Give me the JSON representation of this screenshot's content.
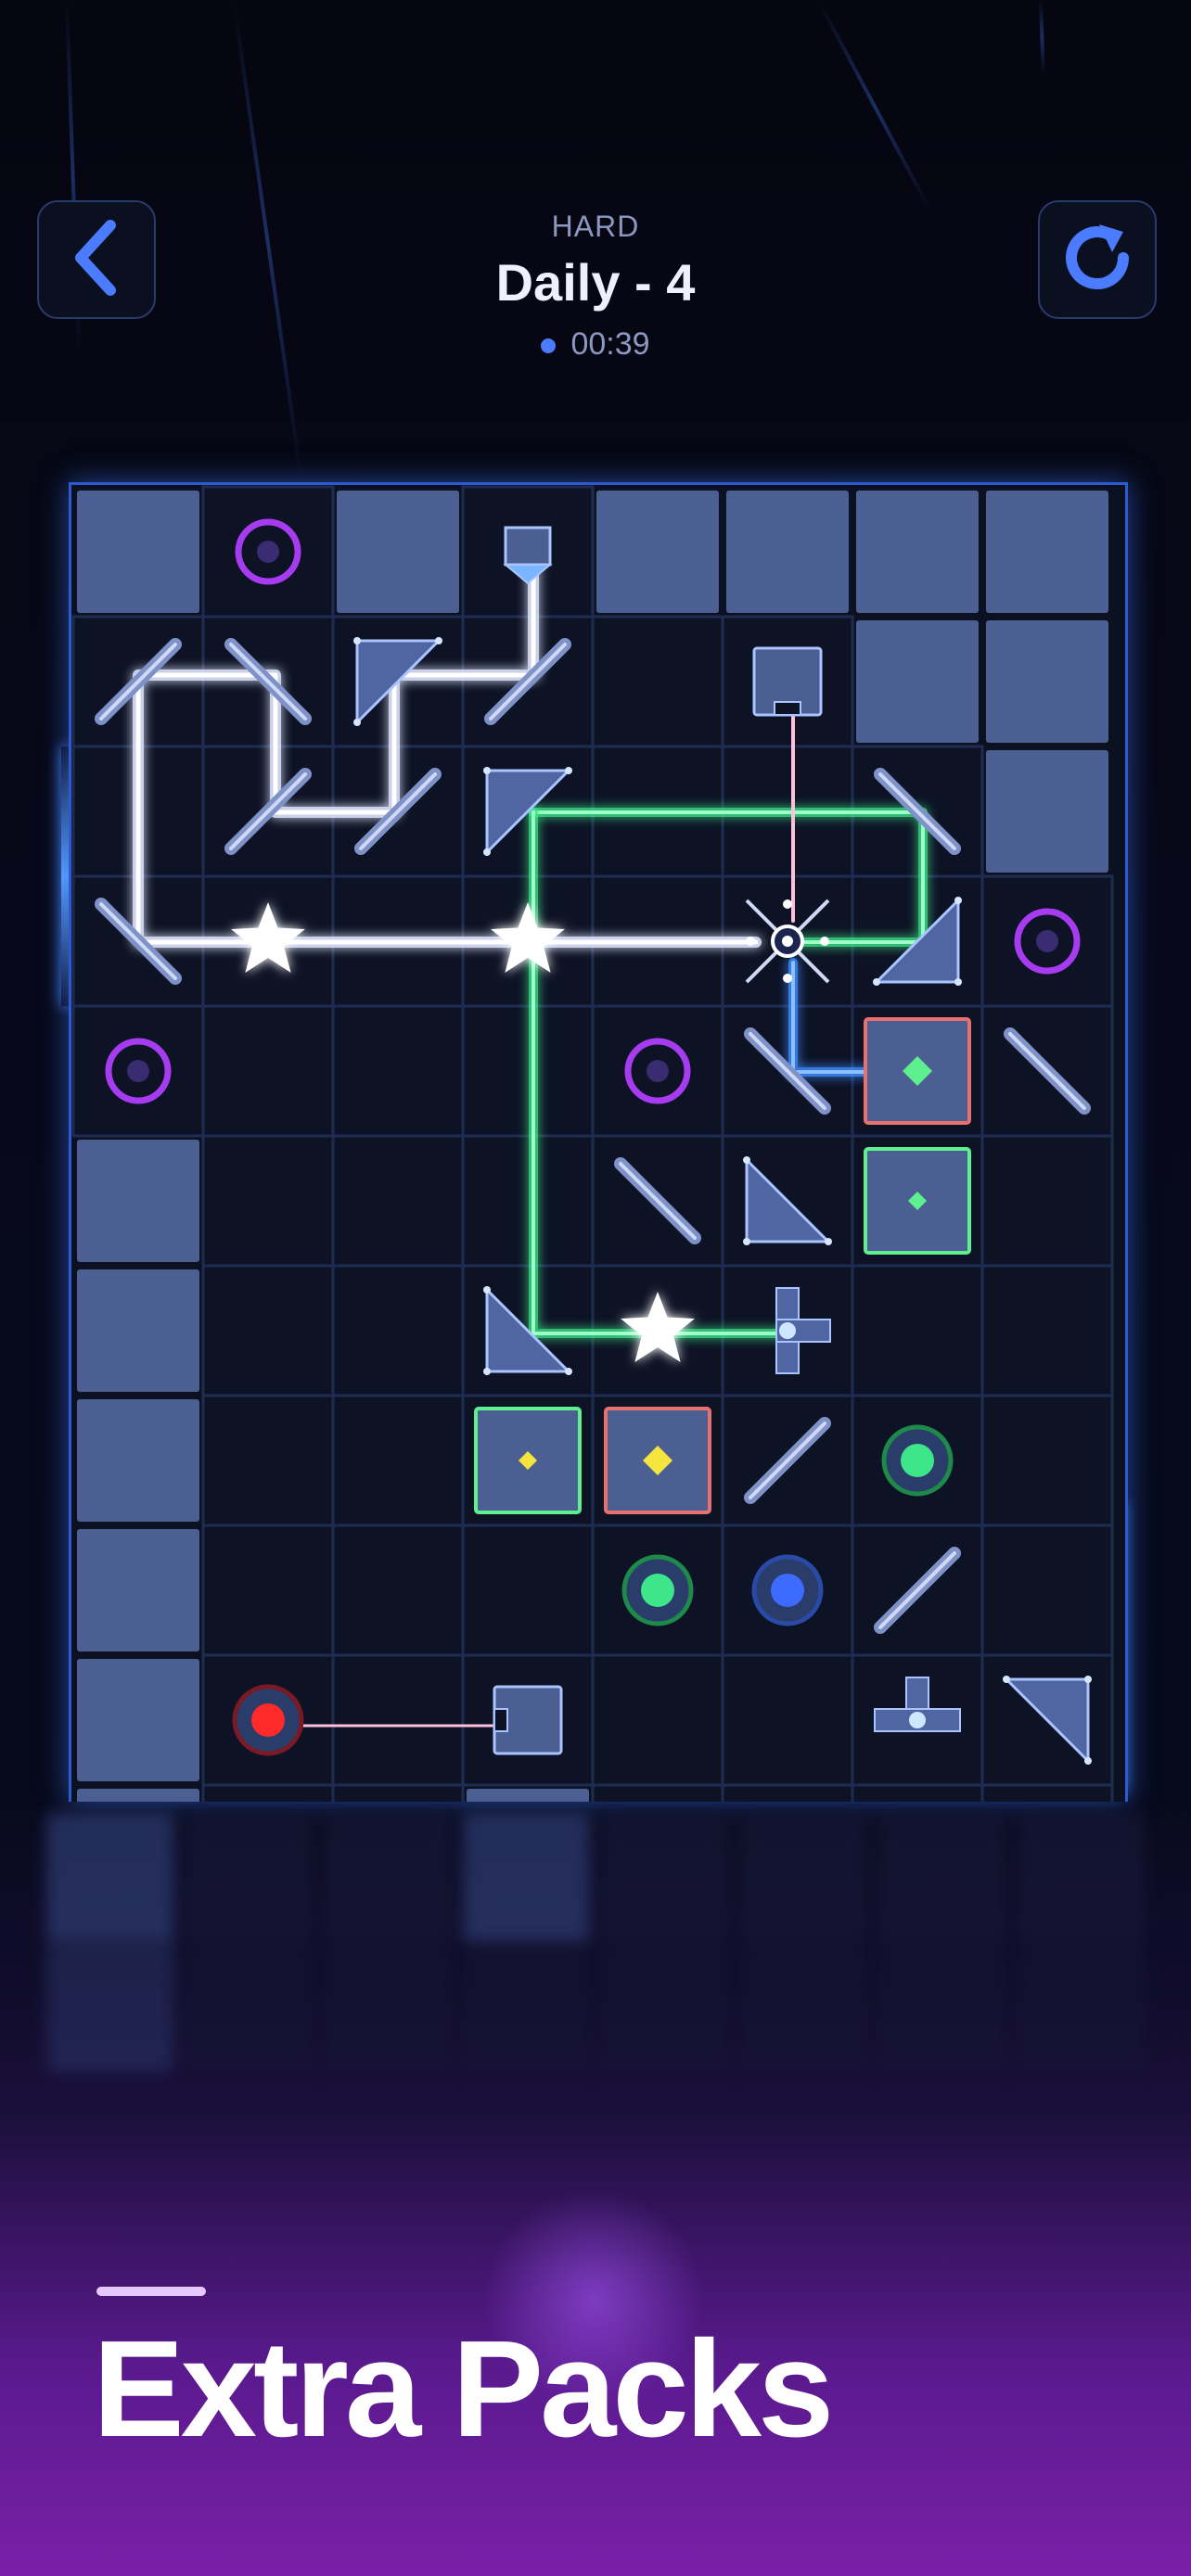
{
  "header": {
    "difficulty": "HARD",
    "level_title": "Daily - 4",
    "timer": "00:39",
    "back_icon": "chevron-left-icon",
    "restart_icon": "restart-icon"
  },
  "colors": {
    "accent_blue": "#4b7bff",
    "beam_white": "#f0f4ff",
    "beam_green": "#3ee68a",
    "beam_pink": "#e38bb5",
    "beam_blue": "#3d8bff",
    "target_purple": "#9b3ff0"
  },
  "banner": {
    "title": "Extra Packs"
  }
}
